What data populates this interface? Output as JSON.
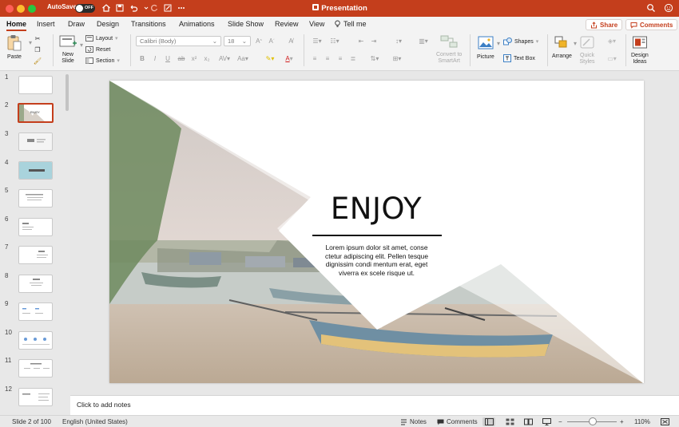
{
  "window": {
    "title": "Presentation",
    "autosave_label": "AutoSave",
    "autosave_state": "OFF",
    "traffic_lights": [
      "#ff5f57",
      "#febc2e",
      "#28c840"
    ],
    "accent": "#c43e1c"
  },
  "ribbon_tabs": [
    "Home",
    "Insert",
    "Draw",
    "Design",
    "Transitions",
    "Animations",
    "Slide Show",
    "Review",
    "View"
  ],
  "active_tab": "Home",
  "tell_me": "Tell me",
  "share_label": "Share",
  "comments_label": "Comments",
  "ribbon": {
    "paste": "Paste",
    "new_slide": [
      "New",
      "Slide"
    ],
    "layout": "Layout",
    "reset": "Reset",
    "section": "Section",
    "font_name": "Calibri (Body)",
    "font_size": "18",
    "convert_smartart": [
      "Convert to",
      "SmartArt"
    ],
    "picture": "Picture",
    "shapes": "Shapes",
    "text_box": "Text Box",
    "arrange": "Arrange",
    "quick_styles": [
      "Quick",
      "Styles"
    ],
    "design_ideas": [
      "Design",
      "Ideas"
    ]
  },
  "slide_numbers": [
    "1",
    "2",
    "3",
    "4",
    "5",
    "6",
    "7",
    "8",
    "9",
    "10",
    "11",
    "12"
  ],
  "selected_slide": 2,
  "slide": {
    "title": "ENJOY",
    "body": "Lorem ipsum dolor sit amet, conse ctetur adipiscing elit. Pellen tesque dignissim condi mentum erat, eget viverra ex scele risque ut.",
    "thumb_title": "ENJOY"
  },
  "notes_placeholder": "Click to add notes",
  "status": {
    "slide_position": "Slide 2 of 100",
    "language": "English (United States)",
    "notes": "Notes",
    "comments": "Comments",
    "zoom": "110%",
    "zoom_fraction": 0.52
  }
}
